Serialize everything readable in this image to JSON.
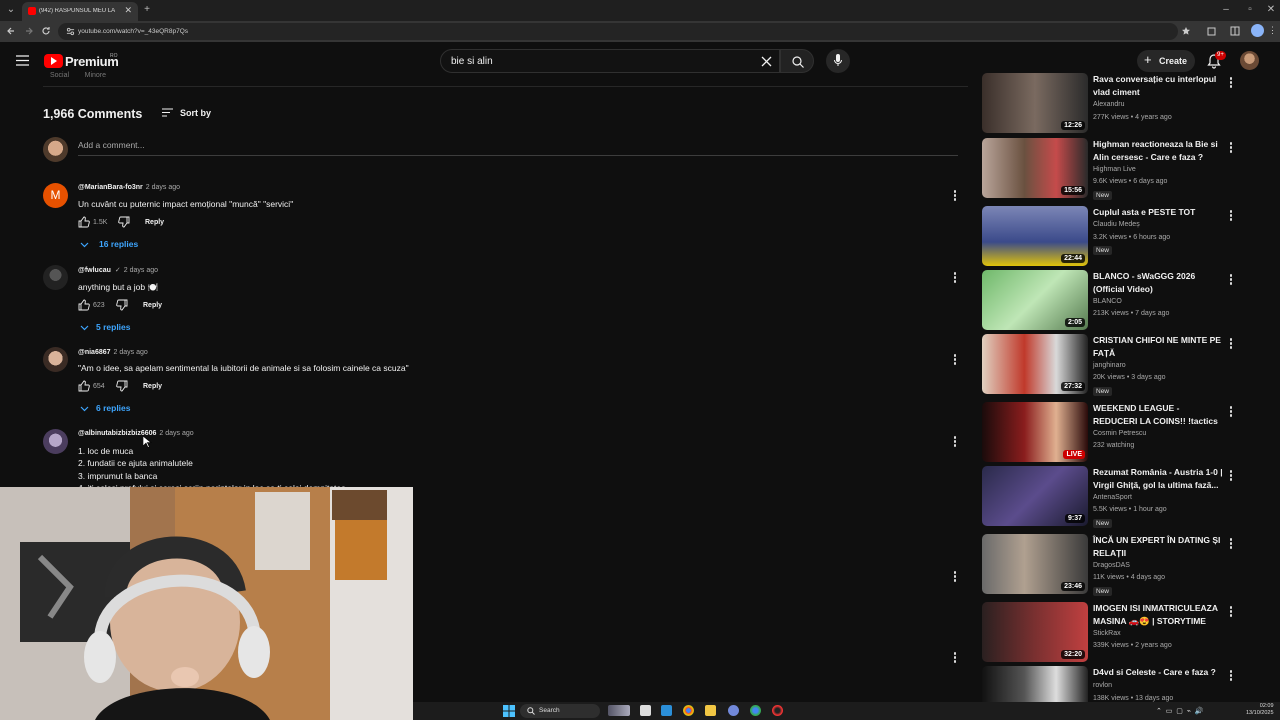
{
  "browser": {
    "tab_title": "(942) RASPUNSUL MEU LA",
    "url": "youtube.com/watch?v=_43eQR8p7Qs"
  },
  "header": {
    "logo_text": "Premium",
    "country_code": "RO",
    "search_query": "bie si alin",
    "create_label": "Create",
    "notif_badge": "9+"
  },
  "comments": {
    "partial_top_text": "Social        Minore",
    "count_label": "1,966 Comments",
    "sort_label": "Sort by",
    "add_placeholder": "Add a comment...",
    "items": [
      {
        "handle": "@MarianBara-fo3nr",
        "date": "2 days ago",
        "text": "Un cuvânt cu puternic impact emoțional \"muncă\" \"servici\"",
        "likes": "1.5K",
        "reply": "Reply",
        "replies": "16 replies",
        "avatar_letter": "M",
        "avatar_color": "#e65100"
      },
      {
        "handle": "@fwlucau",
        "date": "2 days ago",
        "text": "anything but a job 🍽️",
        "likes": "623",
        "reply": "Reply",
        "replies": "5 replies"
      },
      {
        "handle": "@nia6867",
        "date": "2 days ago",
        "text": "\"Am o idee, sa apelam sentimental la iubitorii de animale si sa folosim cainele ca scuza\"",
        "likes": "654",
        "reply": "Reply",
        "replies": "6 replies"
      },
      {
        "handle": "@albinutabizbizbiz6606",
        "date": "2 days ago",
        "lines": [
          "1. loc de muca",
          "2. fundatii ce ajuta animalutele",
          "3. imprumut la banca",
          "4. iti celesi prafului si ceresi scriin parintelor in loc sa ti celei demnitatea"
        ]
      }
    ]
  },
  "sidebar": {
    "videos": [
      {
        "title": "Rava conversație cu interlopul vlad ciment",
        "channel": "Alexandru",
        "stats": "277K views • 4 years ago",
        "duration": "12:26"
      },
      {
        "title": "Highman reactioneaza la Bie si Alin cersesc - Care e faza ?",
        "channel": "Highman Live",
        "stats": "9.6K views • 6 days ago",
        "badge": "New",
        "duration": "15:56"
      },
      {
        "title": "Cuplul asta e PESTE TOT",
        "channel": "Claudiu Medeș",
        "stats": "3.2K views • 6 hours ago",
        "badge": "New",
        "duration": "22:44"
      },
      {
        "title": "BLANCO - sWaGGG 2026 (Official Video)",
        "channel": "BLANCO",
        "stats": "213K views • 7 days ago",
        "duration": "2:05"
      },
      {
        "title": "CRISTIAN CHIFOI NE MINTE PE FAȚĂ",
        "channel": "janghinaro",
        "stats": "20K views • 3 days ago",
        "badge": "New",
        "duration": "27:32"
      },
      {
        "title": "WEEKEND LEAGUE - REDUCERI LA COINS!! !tactics",
        "channel": "Cosmin Petrescu",
        "stats": "232 watching",
        "live": "LIVE"
      },
      {
        "title": "Rezumat România - Austria 1-0 | Virgil Ghiță, gol la ultima fază...",
        "channel": "AntenaSport",
        "stats": "5.5K views • 1 hour ago",
        "badge": "New",
        "duration": "9:37"
      },
      {
        "title": "ÎNCĂ UN EXPERT ÎN DATING ȘI RELAȚII",
        "channel": "DragosDAS",
        "stats": "11K views • 4 days ago",
        "badge": "New",
        "duration": "23:46"
      },
      {
        "title": "IMOGEN ISI INMATRICULEAZA MASINA 🚗😍 | STORYTIME",
        "channel": "StickRax",
        "stats": "339K views • 2 years ago",
        "duration": "32:20"
      },
      {
        "title": "D4vd si Celeste - Care e faza ?",
        "channel": "rovlon",
        "stats": "138K views • 13 days ago"
      }
    ]
  },
  "taskbar": {
    "search_label": "Search",
    "time": "02:09",
    "date": "13/10/2025"
  }
}
